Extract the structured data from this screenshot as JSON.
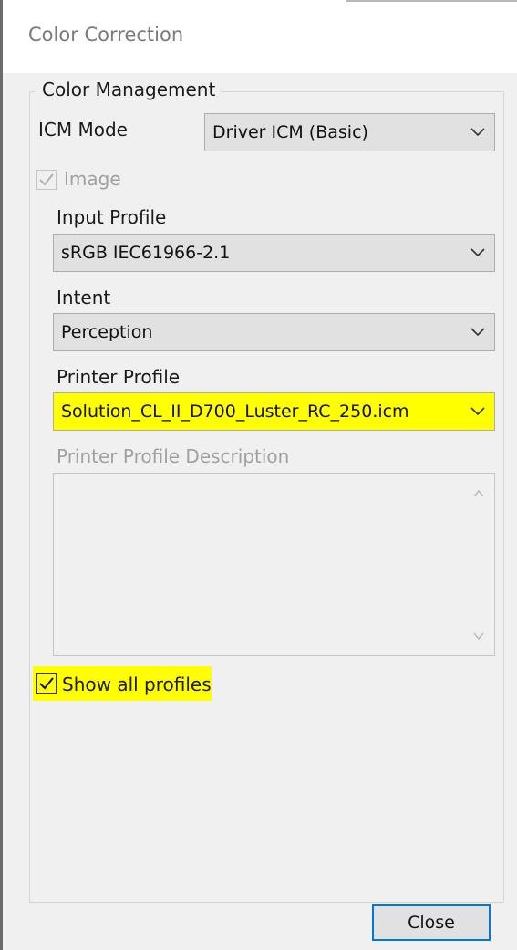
{
  "window": {
    "title": "Color Correction"
  },
  "group": {
    "title": "Color Management"
  },
  "icm_mode": {
    "label": "ICM Mode",
    "value": "Driver ICM (Basic)"
  },
  "image_checkbox": {
    "label": "Image",
    "checked": true,
    "enabled": false
  },
  "input_profile": {
    "label": "Input Profile",
    "value": "sRGB IEC61966-2.1"
  },
  "intent": {
    "label": "Intent",
    "value": "Perception"
  },
  "printer_profile": {
    "label": "Printer Profile",
    "value": "Solution_CL_II_D700_Luster_RC_250.icm",
    "highlight_color": "#ffff00"
  },
  "printer_profile_description": {
    "label": "Printer Profile Description",
    "value": ""
  },
  "show_all_profiles": {
    "label": "Show all profiles",
    "checked": true,
    "highlight_color": "#ffff00"
  },
  "buttons": {
    "close": "Close"
  },
  "colors": {
    "accent": "#0078d7",
    "highlight": "#ffff00",
    "dialog_bg": "#f0f0f0"
  }
}
